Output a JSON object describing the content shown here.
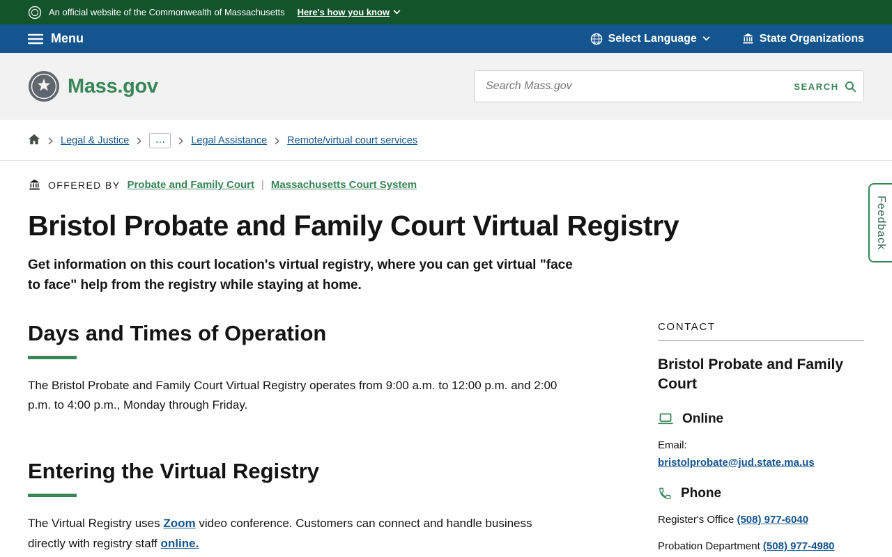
{
  "colors": {
    "banner_green": "#14542c",
    "nav_blue": "#14558f",
    "brand_green": "#388557",
    "link_blue": "#14558f",
    "text_dark": "#141414"
  },
  "banner": {
    "text": "An official website of the Commonwealth of Massachusetts",
    "how_you_know": "Here's how you know"
  },
  "nav": {
    "menu": "Menu",
    "select_language": "Select Language",
    "state_organizations": "State Organizations"
  },
  "header": {
    "logo": "Mass.gov",
    "search_placeholder": "Search Mass.gov",
    "search_button": "SEARCH"
  },
  "breadcrumb": {
    "ellipsis": "…",
    "items": [
      "Legal & Justice",
      "Legal Assistance",
      "Remote/virtual court services"
    ]
  },
  "offered_by": {
    "label": "OFFERED BY",
    "separator": "|",
    "links": [
      "Probate and Family Court",
      "Massachusetts Court System"
    ]
  },
  "page": {
    "title": "Bristol Probate and Family Court Virtual Registry",
    "lede": "Get information on this court location's virtual registry, where you can get virtual \"face to face\" help from the registry while staying at home."
  },
  "sections": {
    "hours": {
      "heading": "Days and Times of Operation",
      "body": "The Bristol Probate and Family Court Virtual Registry operates from 9:00 a.m. to 12:00 p.m. and 2:00 p.m. to 4:00 p.m., Monday through Friday."
    },
    "entering": {
      "heading": "Entering the Virtual Registry",
      "before_zoom": "The Virtual Registry uses ",
      "zoom_link": "Zoom",
      "middle": " video conference. Customers can connect and handle business directly with registry staff ",
      "online_link": "online."
    }
  },
  "contact": {
    "label": "CONTACT",
    "name": "Bristol Probate and Family Court",
    "online": {
      "heading": "Online",
      "email_label": "Email:",
      "email": "bristolprobate@jud.state.ma.us"
    },
    "phone": {
      "heading": "Phone",
      "items": [
        {
          "label": "Register's Office",
          "number": "(508) 977-6040"
        },
        {
          "label": "Probation Department",
          "number": "(508) 977-4980"
        }
      ]
    }
  },
  "feedback": "Feedback"
}
